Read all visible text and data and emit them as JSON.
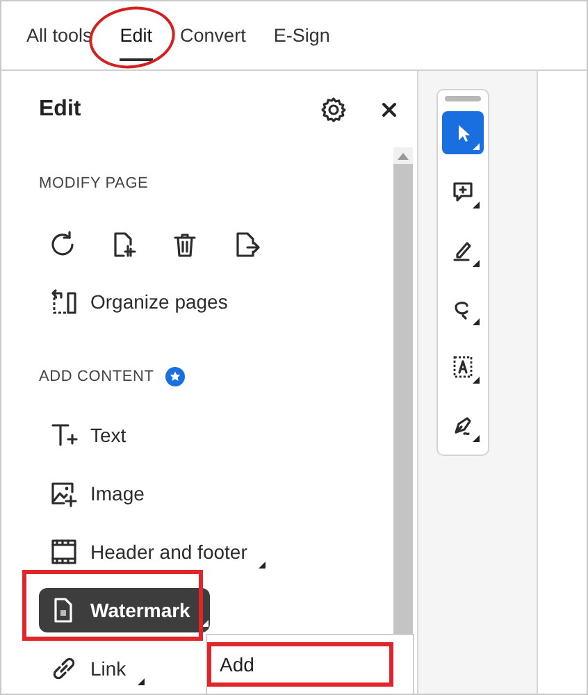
{
  "tabs": [
    {
      "label": "All tools",
      "selected": false,
      "highlighted": false
    },
    {
      "label": "Edit",
      "selected": true,
      "highlighted": true
    },
    {
      "label": "Convert",
      "selected": false,
      "highlighted": false
    },
    {
      "label": "E-Sign",
      "selected": false,
      "highlighted": false
    }
  ],
  "panel": {
    "title": "Edit",
    "modify_page": {
      "heading": "MODIFY PAGE",
      "organize_label": "Organize pages"
    },
    "add_content": {
      "heading": "ADD CONTENT",
      "items": [
        {
          "label": "Text",
          "has_menu": false,
          "selected": false,
          "highlighted": false
        },
        {
          "label": "Image",
          "has_menu": false,
          "selected": false,
          "highlighted": false
        },
        {
          "label": "Header and footer",
          "has_menu": true,
          "selected": false,
          "highlighted": false
        },
        {
          "label": "Watermark",
          "has_menu": true,
          "selected": true,
          "highlighted": true
        },
        {
          "label": "Link",
          "has_menu": true,
          "selected": false,
          "highlighted": false
        }
      ]
    },
    "submenu": {
      "items": [
        {
          "label": "Add",
          "highlighted": true
        }
      ]
    }
  },
  "toolbar": {
    "tools": [
      {
        "selected": true
      },
      {
        "selected": false
      },
      {
        "selected": false
      },
      {
        "selected": false
      },
      {
        "selected": false
      },
      {
        "selected": false
      }
    ]
  }
}
